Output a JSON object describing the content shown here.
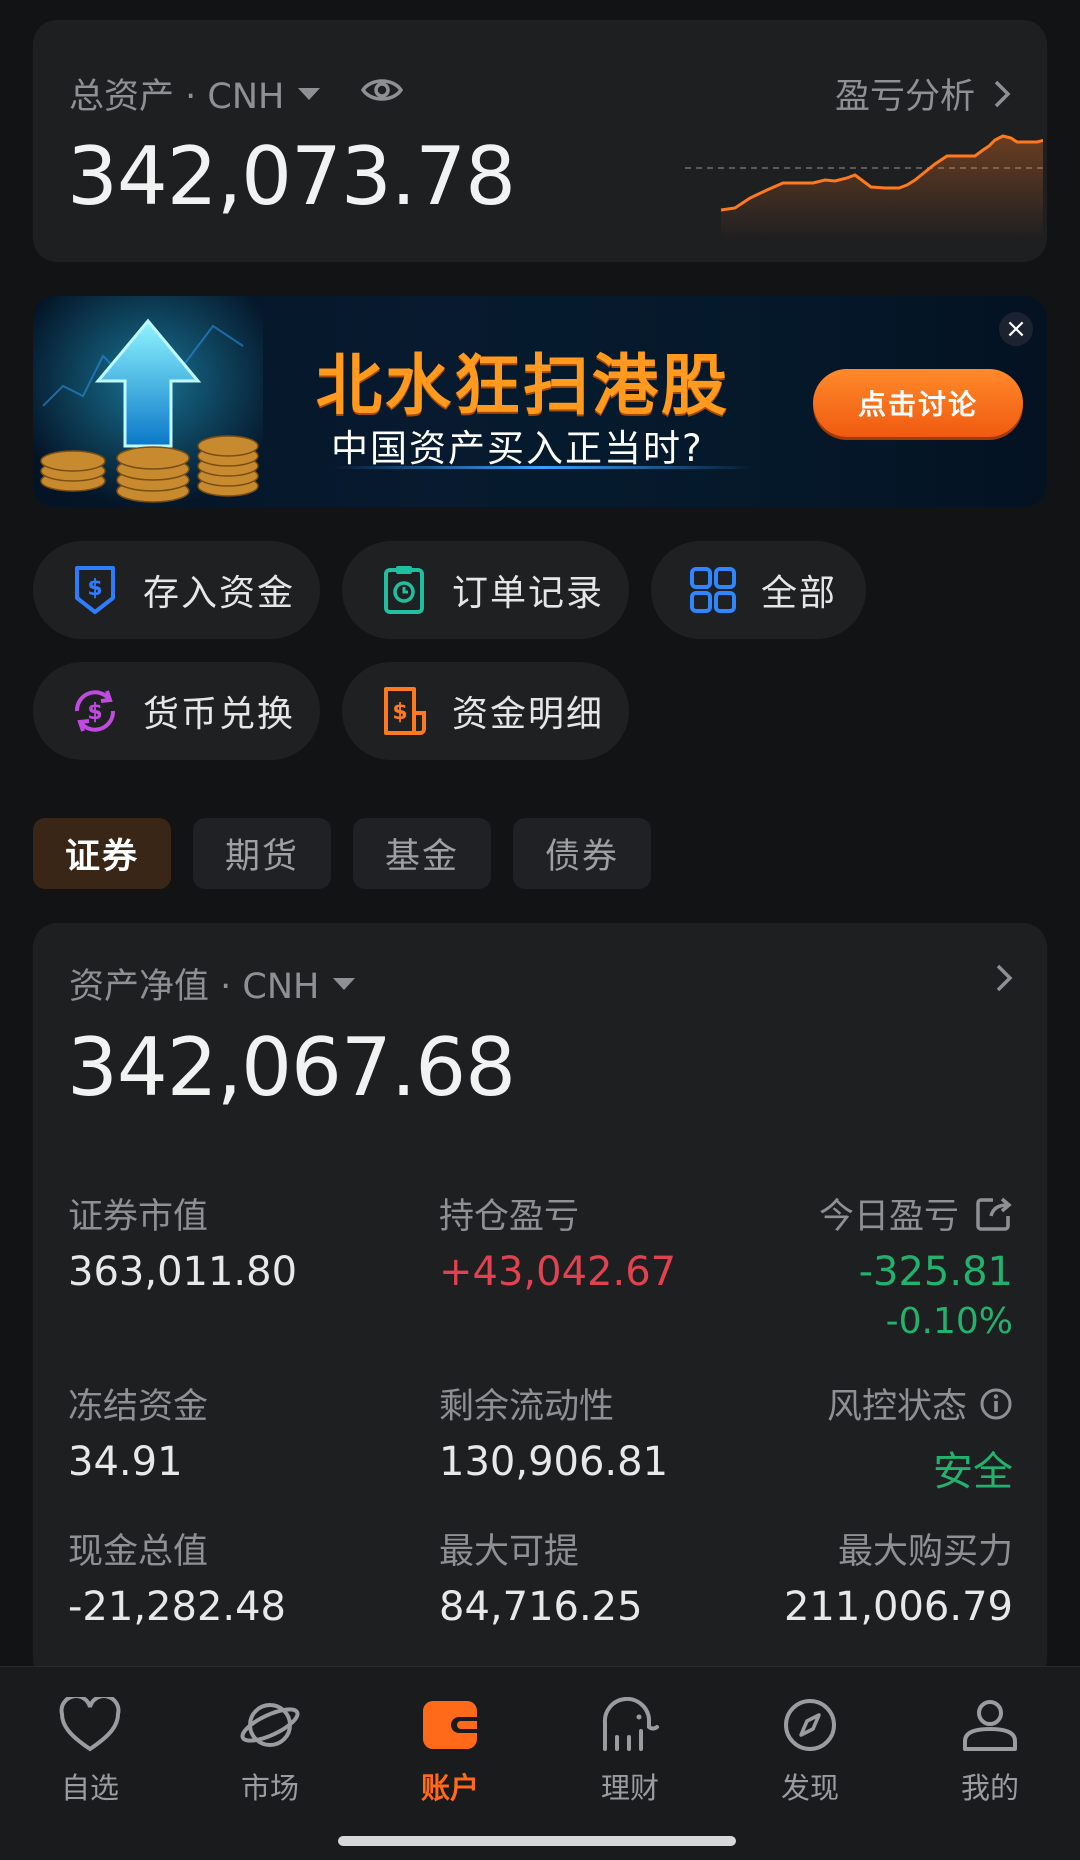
{
  "total_assets": {
    "label": "总资产 · CNH",
    "value": "342,073.78",
    "pnl_link": "盈亏分析"
  },
  "banner": {
    "title": "北水狂扫港股",
    "subtitle": "中国资产买入正当时?",
    "cta": "点击讨论",
    "close": "×"
  },
  "quick_actions": [
    {
      "label": "存入资金",
      "icon": "deposit-icon",
      "color": "#2f7dff"
    },
    {
      "label": "订单记录",
      "icon": "clipboard-icon",
      "color": "#1fbfa0"
    },
    {
      "label": "全部",
      "icon": "grid-icon",
      "color": "#2f86ff"
    },
    {
      "label": "货币兑换",
      "icon": "currency-exchange-icon",
      "color": "#c14be0"
    },
    {
      "label": "资金明细",
      "icon": "fund-detail-icon",
      "color": "#ff7a1f"
    }
  ],
  "tabs": [
    {
      "label": "证券",
      "active": true
    },
    {
      "label": "期货",
      "active": false
    },
    {
      "label": "基金",
      "active": false
    },
    {
      "label": "债券",
      "active": false
    }
  ],
  "net_assets": {
    "label": "资产净值 · CNH",
    "value": "342,067.68",
    "metrics": {
      "securities_value": {
        "label": "证券市值",
        "value": "363,011.80"
      },
      "position_pnl": {
        "label": "持仓盈亏",
        "value": "+43,042.67"
      },
      "today_pnl": {
        "label": "今日盈亏",
        "value": "-325.81",
        "percent": "-0.10%"
      },
      "frozen_funds": {
        "label": "冻结资金",
        "value": "34.91"
      },
      "remaining_liquidity": {
        "label": "剩余流动性",
        "value": "130,906.81"
      },
      "risk_status": {
        "label": "风控状态",
        "value": "安全"
      },
      "cash_total": {
        "label": "现金总值",
        "value": "-21,282.48"
      },
      "max_withdrawable": {
        "label": "最大可提",
        "value": "84,716.25"
      },
      "max_buying_power": {
        "label": "最大购买力",
        "value": "211,006.79"
      }
    }
  },
  "bottom_nav": [
    {
      "label": "自选",
      "icon": "heart-icon",
      "active": false
    },
    {
      "label": "市场",
      "icon": "planet-icon",
      "active": false
    },
    {
      "label": "账户",
      "icon": "wallet-icon",
      "active": true
    },
    {
      "label": "理财",
      "icon": "elephant-icon",
      "active": false
    },
    {
      "label": "发现",
      "icon": "compass-icon",
      "active": false
    },
    {
      "label": "我的",
      "icon": "profile-icon",
      "active": false
    }
  ],
  "colors": {
    "accent": "#ff6a1a",
    "gain_red": "#e0424f",
    "loss_green": "#23b26d",
    "background": "#121314",
    "card": "#1e1f21"
  }
}
